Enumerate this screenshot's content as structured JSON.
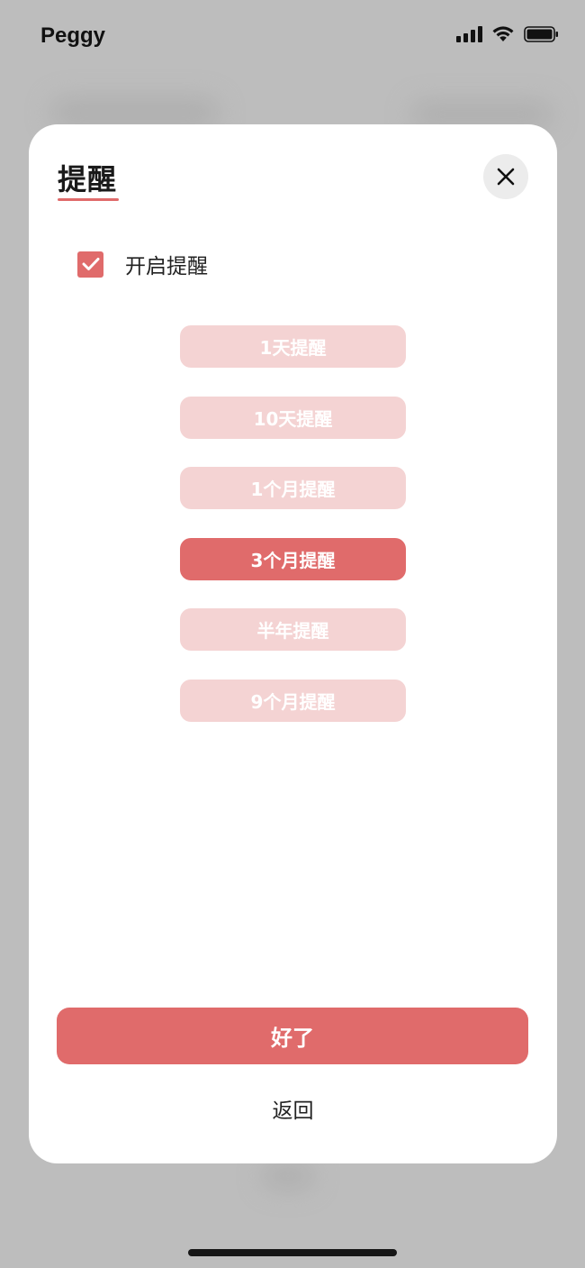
{
  "status_bar": {
    "carrier": "Peggy",
    "icons": [
      "cellular-signal-icon",
      "wifi-icon",
      "battery-icon"
    ]
  },
  "modal": {
    "title": "提醒",
    "close_icon": "close-icon",
    "enable_toggle": {
      "label": "开启提醒",
      "checked": true
    },
    "options": [
      {
        "label": "1天提醒",
        "selected": false
      },
      {
        "label": "10天提醒",
        "selected": false
      },
      {
        "label": "1个月提醒",
        "selected": false
      },
      {
        "label": "3个月提醒",
        "selected": true
      },
      {
        "label": "半年提醒",
        "selected": false
      },
      {
        "label": "9个月提醒",
        "selected": false
      }
    ],
    "ok_label": "好了",
    "back_label": "返回"
  },
  "colors": {
    "accent": "#e06b6b",
    "option_inactive": "#f4d3d3",
    "overlay_bg": "#bdbdbd"
  }
}
